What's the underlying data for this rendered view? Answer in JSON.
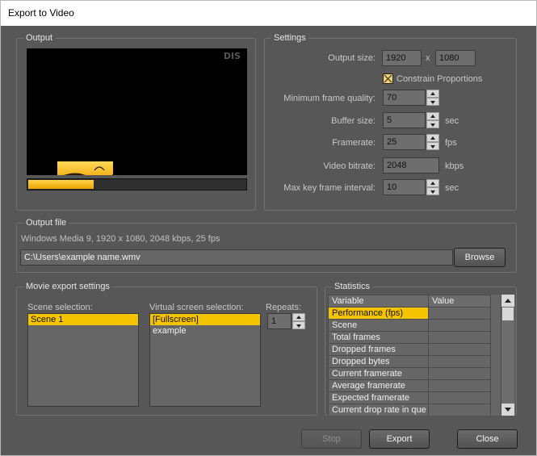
{
  "window": {
    "title": "Export to Video"
  },
  "output": {
    "title": "Output",
    "watermark": "DIS",
    "progress": 0.3
  },
  "settings": {
    "title": "Settings",
    "output_size_label": "Output size:",
    "width": "1920",
    "x_label": "x",
    "height": "1080",
    "constrain_label": "Constrain Proportions",
    "constrain_checked": true,
    "min_quality_label": "Minimum frame quality:",
    "min_quality": "70",
    "buffer_label": "Buffer size:",
    "buffer": "5",
    "buffer_unit": "sec",
    "framerate_label": "Framerate:",
    "framerate": "25",
    "framerate_unit": "fps",
    "bitrate_label": "Video bitrate:",
    "bitrate": "2048",
    "bitrate_unit": "kbps",
    "keyframe_label": "Max key frame interval:",
    "keyframe": "10",
    "keyframe_unit": "sec"
  },
  "output_file": {
    "title": "Output file",
    "info": "Windows Media 9, 1920 x 1080, 2048 kbps, 25 fps",
    "path": "C:\\Users\\example name.wmv",
    "browse_label": "Browse"
  },
  "movie": {
    "title": "Movie export settings",
    "scene_label": "Scene selection:",
    "scenes": [
      "Scene 1"
    ],
    "vscreen_label": "Virtual screen selection:",
    "vscreens": [
      "[Fullscreen]",
      "example"
    ],
    "repeats_label": "Repeats:",
    "repeats": "1"
  },
  "statistics": {
    "title": "Statistics",
    "columns": [
      "Variable",
      "Value"
    ],
    "rows": [
      "Performance (fps)",
      "Scene",
      "Total frames",
      "Dropped frames",
      "Dropped bytes",
      "Current framerate",
      "Average framerate",
      "Expected framerate",
      "Current drop rate in que"
    ]
  },
  "buttons": {
    "stop": "Stop",
    "export": "Export",
    "close": "Close"
  },
  "colors": {
    "background": "#575757",
    "accent": "#f5c400",
    "preview_sun": "#ffcc33"
  }
}
